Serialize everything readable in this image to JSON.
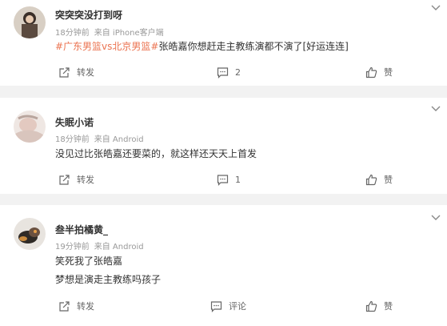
{
  "comments": [
    {
      "username": "突突突没打到呀",
      "time": "18分钟前",
      "source": "来自 iPhone客户端",
      "topic": "#广东男篮vs北京男篮#",
      "text": "张皓嘉你想赶走主教练演都不演了[好运连连]",
      "actions": {
        "repost": "转发",
        "comment": "2",
        "like": "赞"
      }
    },
    {
      "username": "失眠小诺",
      "time": "18分钟前",
      "source": "来自 Android",
      "text": "没见过比张皓嘉还要菜的，就这样还天天上首发",
      "actions": {
        "repost": "转发",
        "comment": "1",
        "like": "赞"
      }
    },
    {
      "username": "叁半拍橘黄_",
      "time": "19分钟前",
      "source": "来自 Android",
      "text_lines": [
        "笑死我了张皓嘉",
        "梦想是演走主教练吗孩子"
      ],
      "actions": {
        "repost": "转发",
        "comment": "评论",
        "like": "赞"
      }
    }
  ],
  "colors": {
    "topic": "#eb7350",
    "background": "#f2f2f2",
    "meta": "#999999"
  },
  "icons": [
    "repost-icon",
    "comment-icon",
    "like-icon",
    "chevron-down-icon"
  ]
}
